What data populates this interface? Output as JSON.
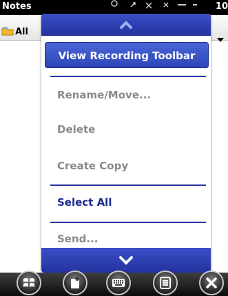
{
  "status_bar": {
    "app_title": "Notes",
    "time": "10"
  },
  "folder_bar": {
    "folder_name": "All"
  },
  "menu": {
    "items": [
      {
        "label": "View Recording Toolbar",
        "state": "highlighted"
      },
      {
        "label": "Rename/Move...",
        "state": "disabled"
      },
      {
        "label": "Delete",
        "state": "disabled"
      },
      {
        "label": "Create Copy",
        "state": "disabled"
      },
      {
        "label": "Select All",
        "state": "enabled"
      },
      {
        "label": "Send...",
        "state": "disabled"
      }
    ],
    "scroll_up_icon": "chevron-up-icon",
    "scroll_down_icon": "chevron-down-icon"
  },
  "taskbar": {
    "buttons": [
      "windows-start-icon",
      "new-note-icon",
      "keyboard-icon",
      "menu-list-icon",
      "close-icon"
    ]
  },
  "colors": {
    "menu_blue": "#2d45b8",
    "menu_text_enabled": "#1b2a8c",
    "menu_text_disabled": "#8a8a8a",
    "status_bar": "#000000"
  }
}
